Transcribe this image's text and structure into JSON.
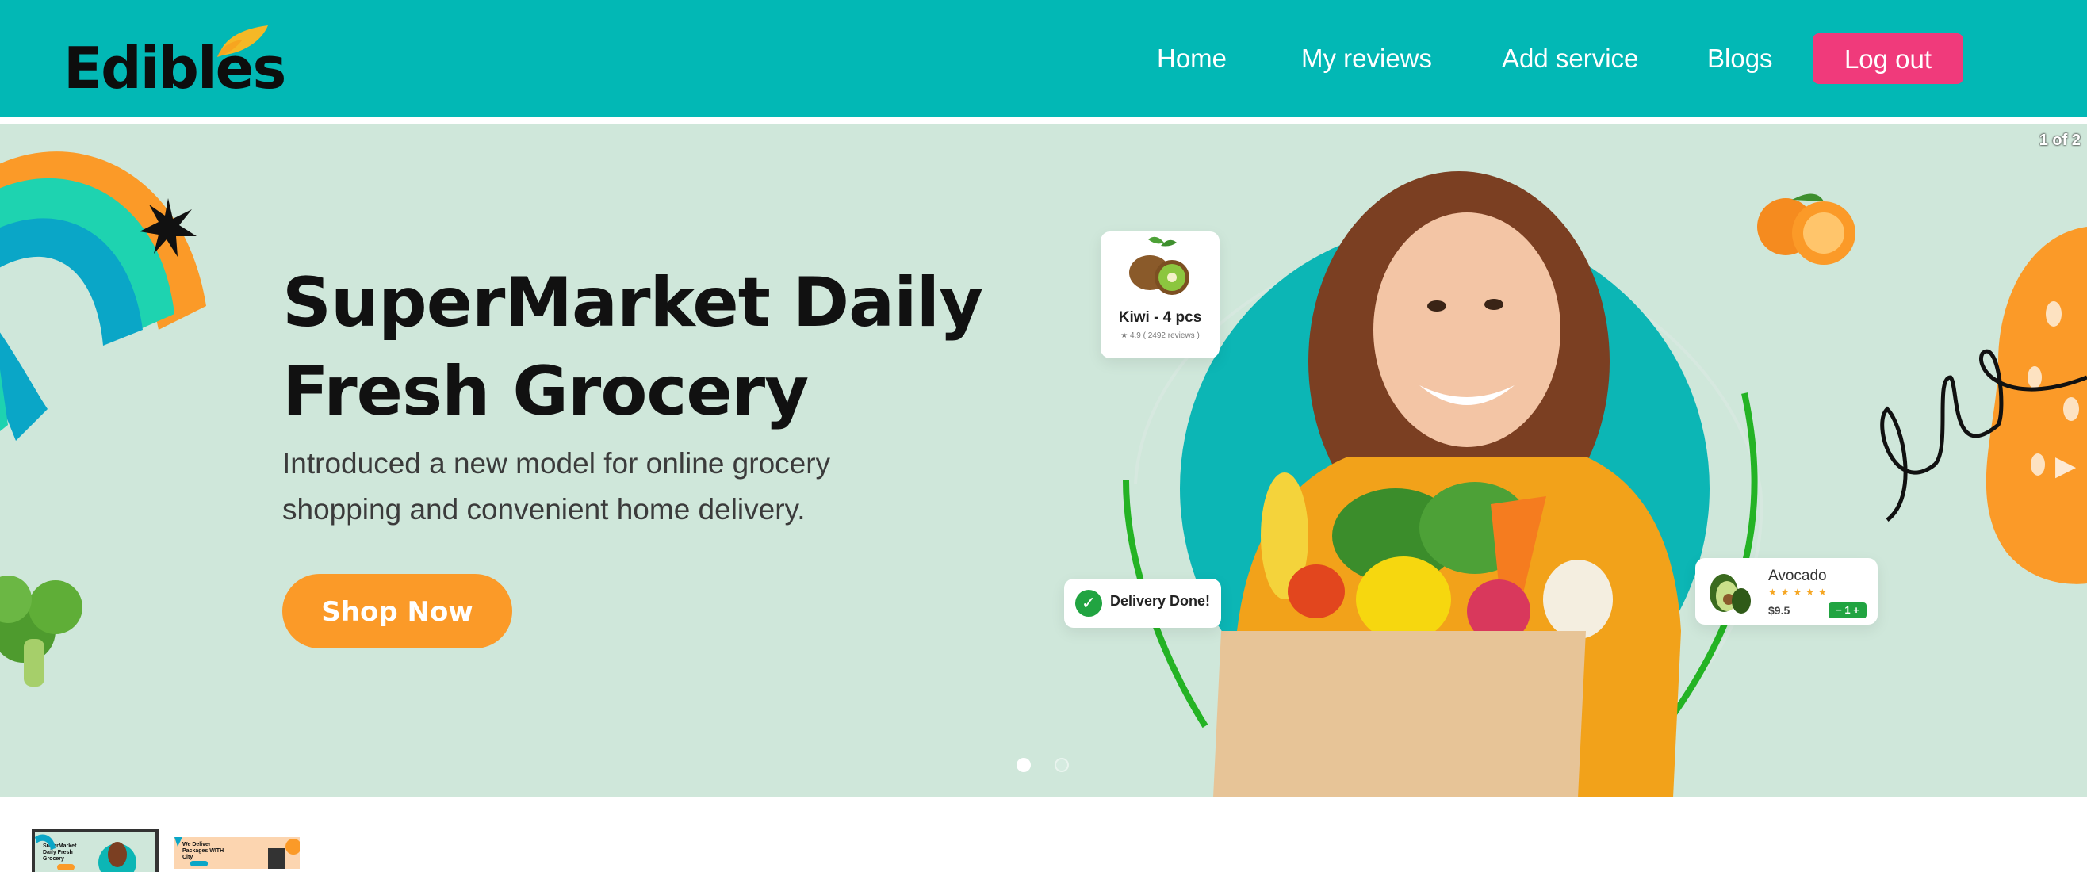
{
  "brand": {
    "name": "Edibles"
  },
  "nav": {
    "items": [
      {
        "label": "Home"
      },
      {
        "label": "My reviews"
      },
      {
        "label": "Add service"
      },
      {
        "label": "Blogs"
      }
    ],
    "logout_label": "Log out"
  },
  "carousel": {
    "counter": "1 of 2",
    "total_slides": 2,
    "active_index": 1
  },
  "hero": {
    "headline_line1": "SuperMarket Daily",
    "headline_line2": "Fresh Grocery",
    "subtext_line1": "Introduced a new model for online grocery",
    "subtext_line2": "shopping and convenient home delivery.",
    "cta_label": "Shop Now"
  },
  "cards": {
    "kiwi": {
      "name": "Kiwi - 4 pcs",
      "rating": "★ 4.9  ( 2492 reviews )"
    },
    "delivery": {
      "text": "Delivery Done!"
    },
    "avocado": {
      "name": "Avocado",
      "stars": "★★★★★",
      "price": "$9.5",
      "qty": "− 1 +"
    }
  },
  "thumbnails": [
    {
      "title": "SuperMarket Daily Fresh Grocery"
    },
    {
      "title": "We Deliver Packages WITH City"
    }
  ],
  "colors": {
    "header_bg": "#02b8b5",
    "logout_bg": "#f03a7b",
    "hero_bg": "#cfe7da",
    "cta_bg": "#fb9a28",
    "accent_green": "#21a441",
    "accent_orange": "#fb9a28",
    "teal_circle": "#0cb6b5"
  },
  "icons": [
    "leaf-logo-icon",
    "check-icon",
    "chevron-right-icon",
    "star-icon"
  ]
}
